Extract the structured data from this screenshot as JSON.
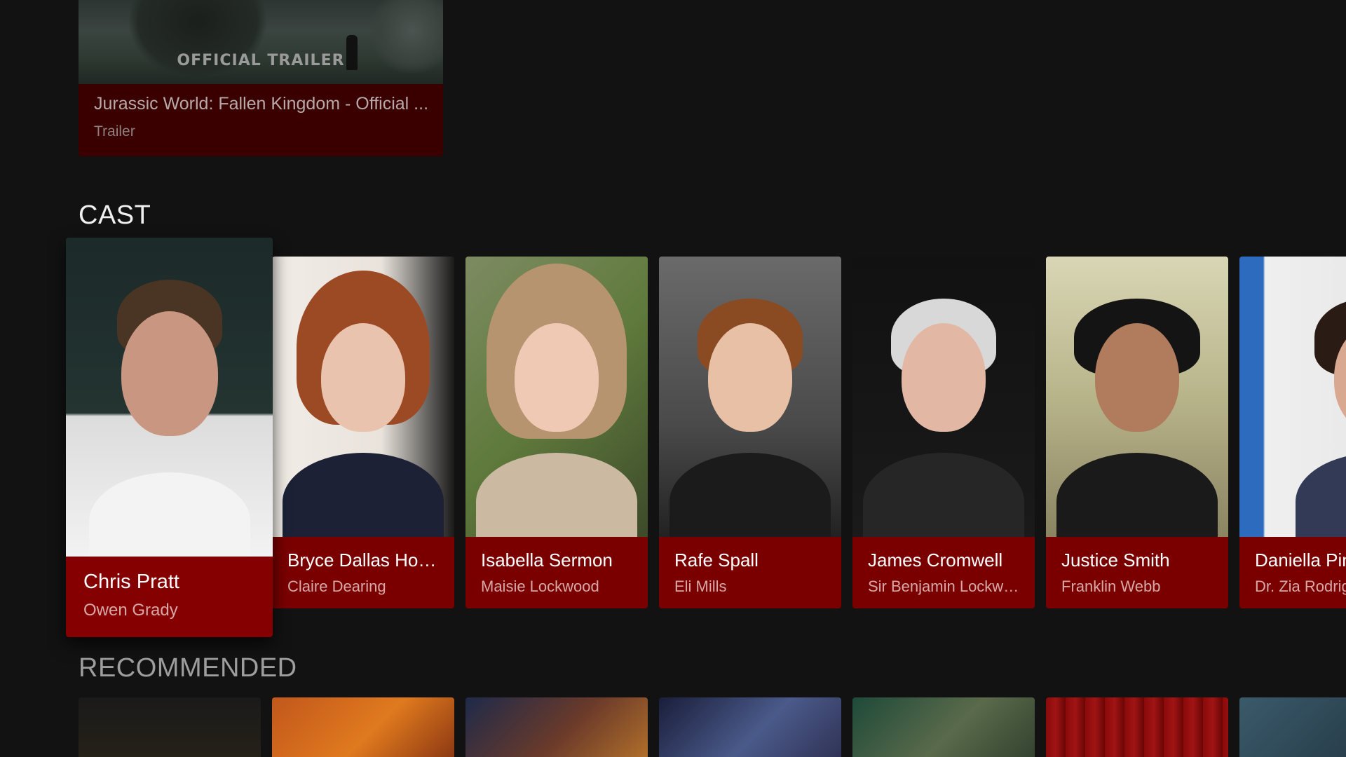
{
  "trailer": {
    "watermark": "OFFICIAL TRAILER",
    "title": "Jurassic World: Fallen Kingdom - Official ...",
    "subtitle": "Trailer"
  },
  "cast_section": {
    "title": "CAST",
    "items": [
      {
        "name": "Chris Pratt",
        "role": "Owen Grady"
      },
      {
        "name": "Bryce Dallas How...",
        "role": "Claire Dearing"
      },
      {
        "name": "Isabella Sermon",
        "role": "Maisie Lockwood"
      },
      {
        "name": "Rafe Spall",
        "role": "Eli Mills"
      },
      {
        "name": "James Cromwell",
        "role": "Sir Benjamin Lockwo..."
      },
      {
        "name": "Justice Smith",
        "role": "Franklin Webb"
      },
      {
        "name": "Daniella Pineda",
        "role": "Dr. Zia Rodriguez"
      }
    ]
  },
  "recommended_section": {
    "title": "RECOMMENDED"
  },
  "colors": {
    "background": "#121212",
    "card_red": "#7a0000",
    "focused_card_red": "#850000",
    "trailer_card": "#3a0000"
  }
}
